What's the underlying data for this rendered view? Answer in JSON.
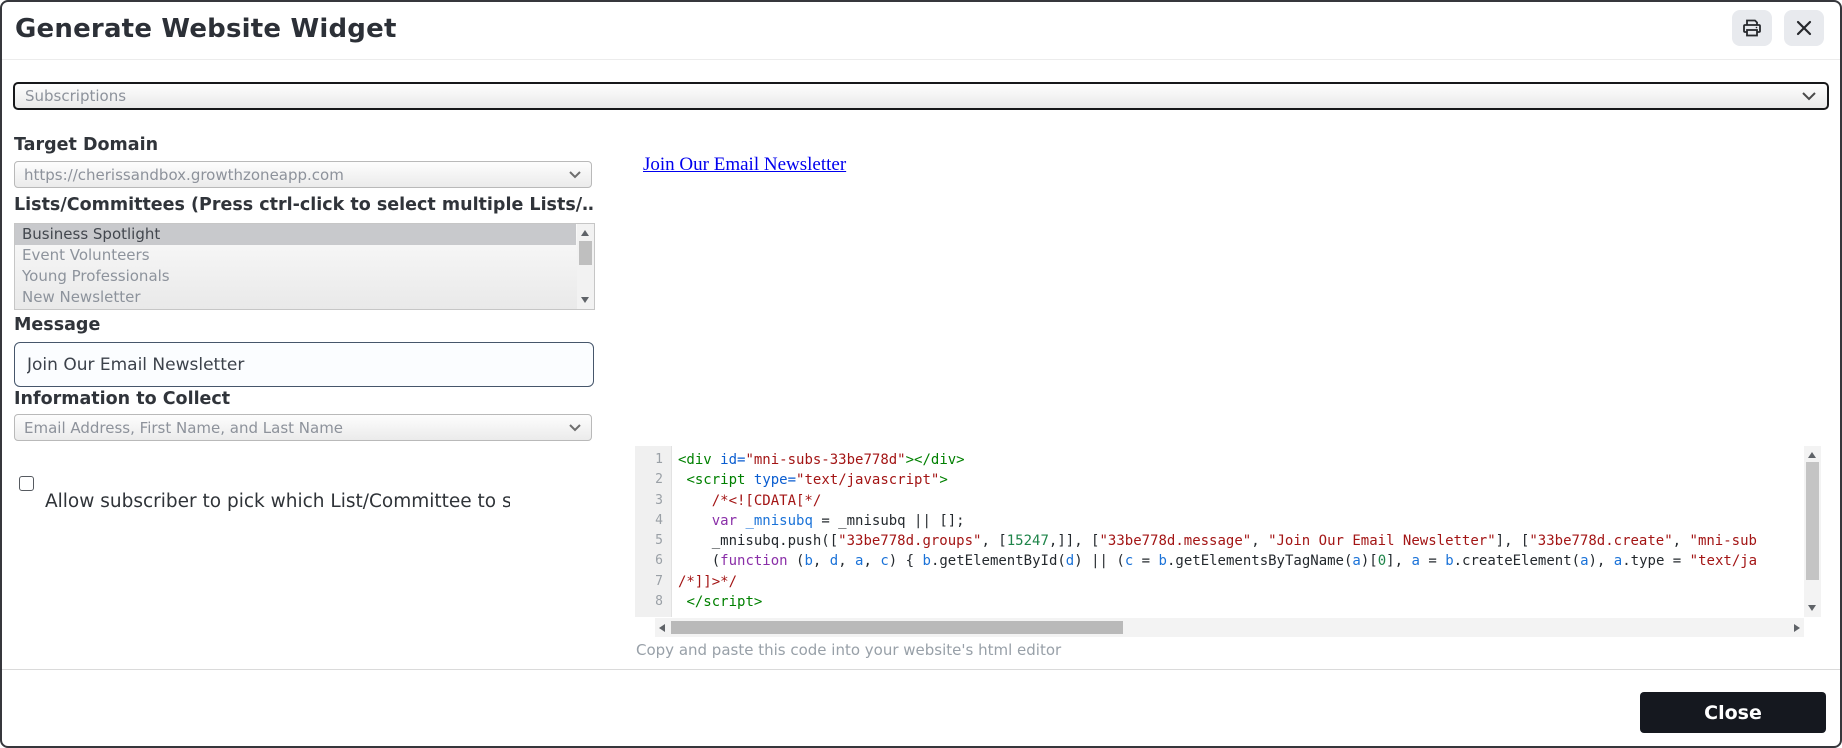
{
  "header": {
    "title": "Generate Website Widget",
    "print_icon": "printer-icon",
    "close_icon": "x-icon"
  },
  "widget_type_select": {
    "value": "Subscriptions"
  },
  "form": {
    "target_domain": {
      "label": "Target Domain",
      "value": "https://cherissandbox.growthzoneapp.com"
    },
    "lists_committees": {
      "label": "Lists/Committees (Press ctrl-click to select multiple Lists/…",
      "options": [
        {
          "label": "Business Spotlight",
          "selected": true
        },
        {
          "label": "Event Volunteers",
          "selected": false
        },
        {
          "label": "Young Professionals",
          "selected": false
        },
        {
          "label": "New Newsletter",
          "selected": false
        }
      ]
    },
    "message": {
      "label": "Message",
      "value": "Join Our Email Newsletter"
    },
    "information_to_collect": {
      "label": "Information to Collect",
      "value": "Email Address, First Name, and Last Name"
    },
    "allow_subscriber": {
      "label": "Allow subscriber to pick which List/Committee to sub…",
      "checked": false
    }
  },
  "preview": {
    "link_text": "Join Our Email Newsletter"
  },
  "code": {
    "hint": "Copy and paste this code into your website's html editor",
    "lines": [
      [
        [
          "tag",
          "<div"
        ],
        [
          "plain",
          " "
        ],
        [
          "attr",
          "id="
        ],
        [
          "str",
          "\"mni-subs-33be778d\""
        ],
        [
          "tag",
          "></div>"
        ]
      ],
      [
        [
          "plain",
          " "
        ],
        [
          "tag",
          "<script"
        ],
        [
          "plain",
          " "
        ],
        [
          "attr",
          "type="
        ],
        [
          "str",
          "\"text/javascript\""
        ],
        [
          "tag",
          ">"
        ]
      ],
      [
        [
          "plain",
          "    "
        ],
        [
          "cdata",
          "/*<![CDATA[*/"
        ]
      ],
      [
        [
          "plain",
          "    "
        ],
        [
          "kw",
          "var"
        ],
        [
          "plain",
          " "
        ],
        [
          "var",
          "_mnisubq"
        ],
        [
          "plain",
          " = _mnisubq || [];"
        ]
      ],
      [
        [
          "plain",
          "    _mnisubq.push(["
        ],
        [
          "str",
          "\"33be778d.groups\""
        ],
        [
          "plain",
          ", ["
        ],
        [
          "num",
          "15247"
        ],
        [
          "plain",
          ",]], ["
        ],
        [
          "str",
          "\"33be778d.message\""
        ],
        [
          "plain",
          ", "
        ],
        [
          "str",
          "\"Join Our Email Newsletter\""
        ],
        [
          "plain",
          "], ["
        ],
        [
          "str",
          "\"33be778d.create\""
        ],
        [
          "plain",
          ", "
        ],
        [
          "str",
          "\"mni-sub"
        ]
      ],
      [
        [
          "plain",
          "    ("
        ],
        [
          "kw",
          "function"
        ],
        [
          "plain",
          " ("
        ],
        [
          "var",
          "b"
        ],
        [
          "plain",
          ", "
        ],
        [
          "var",
          "d"
        ],
        [
          "plain",
          ", "
        ],
        [
          "var",
          "a"
        ],
        [
          "plain",
          ", "
        ],
        [
          "var",
          "c"
        ],
        [
          "plain",
          ") { "
        ],
        [
          "var",
          "b"
        ],
        [
          "plain",
          ".getElementById("
        ],
        [
          "var",
          "d"
        ],
        [
          "plain",
          ") || ("
        ],
        [
          "var",
          "c"
        ],
        [
          "plain",
          " = "
        ],
        [
          "var",
          "b"
        ],
        [
          "plain",
          ".getElementsByTagName("
        ],
        [
          "var",
          "a"
        ],
        [
          "plain",
          ")["
        ],
        [
          "num",
          "0"
        ],
        [
          "plain",
          "], "
        ],
        [
          "var",
          "a"
        ],
        [
          "plain",
          " = "
        ],
        [
          "var",
          "b"
        ],
        [
          "plain",
          ".createElement("
        ],
        [
          "var",
          "a"
        ],
        [
          "plain",
          "), "
        ],
        [
          "var",
          "a"
        ],
        [
          "plain",
          ".type = "
        ],
        [
          "str",
          "\"text/ja"
        ]
      ],
      [
        [
          "cdata",
          "/*]]>*/"
        ]
      ],
      [
        [
          "plain",
          " "
        ],
        [
          "tag",
          "</script>"
        ]
      ]
    ]
  },
  "footer": {
    "close_label": "Close"
  },
  "colors": {
    "close_button_bg": "#15181f",
    "link": "#0000ee",
    "selected_row_bg": "#c8c9cc",
    "syntax": {
      "tag": "#008000",
      "attr": "#0a5dd0",
      "str": "#a31515",
      "kw": "#8a2fa8",
      "var": "#1a72d8",
      "num": "#1e8449",
      "plain": "#24292e",
      "cdata": "#a31515"
    }
  }
}
